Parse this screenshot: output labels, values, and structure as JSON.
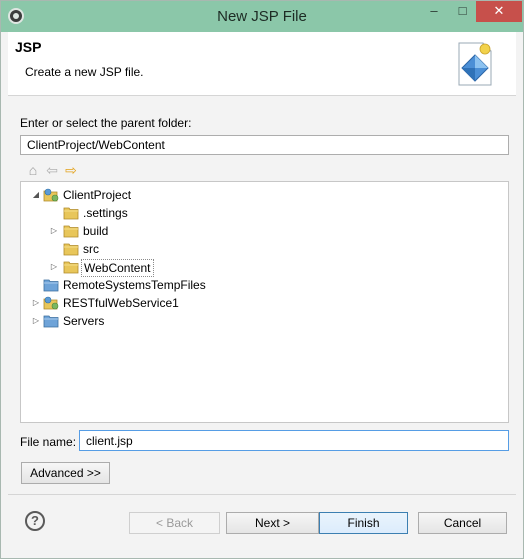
{
  "window": {
    "title": "New JSP File"
  },
  "title_buttons": {
    "minimize": "–",
    "maximize": "□",
    "close": "✕"
  },
  "banner": {
    "title": "JSP",
    "description": "Create a new JSP file."
  },
  "folder": {
    "label": "Enter or select the parent folder:",
    "value": "ClientProject/WebContent"
  },
  "tree": {
    "items": [
      {
        "label": "ClientProject",
        "expanded": true,
        "type": "project"
      },
      {
        "label": ".settings",
        "type": "folder"
      },
      {
        "label": "build",
        "type": "folder",
        "expandable": true
      },
      {
        "label": "src",
        "type": "folder"
      },
      {
        "label": "WebContent",
        "type": "folder",
        "expandable": true,
        "selected": true
      },
      {
        "label": "RemoteSystemsTempFiles",
        "type": "project"
      },
      {
        "label": "RESTfulWebService1",
        "type": "project",
        "expandable": true
      },
      {
        "label": "Servers",
        "type": "folder",
        "expandable": true
      }
    ]
  },
  "file": {
    "label": "File name:",
    "value": "client.jsp"
  },
  "buttons": {
    "advanced": "Advanced >>",
    "back": "< Back",
    "next": "Next >",
    "finish": "Finish",
    "cancel": "Cancel",
    "help": "?"
  },
  "colors": {
    "title_bar": "#8bc7a9",
    "close_button": "#c7504b",
    "folder_yellow": "#e8c65a",
    "finish_border": "#3c7fb1"
  }
}
